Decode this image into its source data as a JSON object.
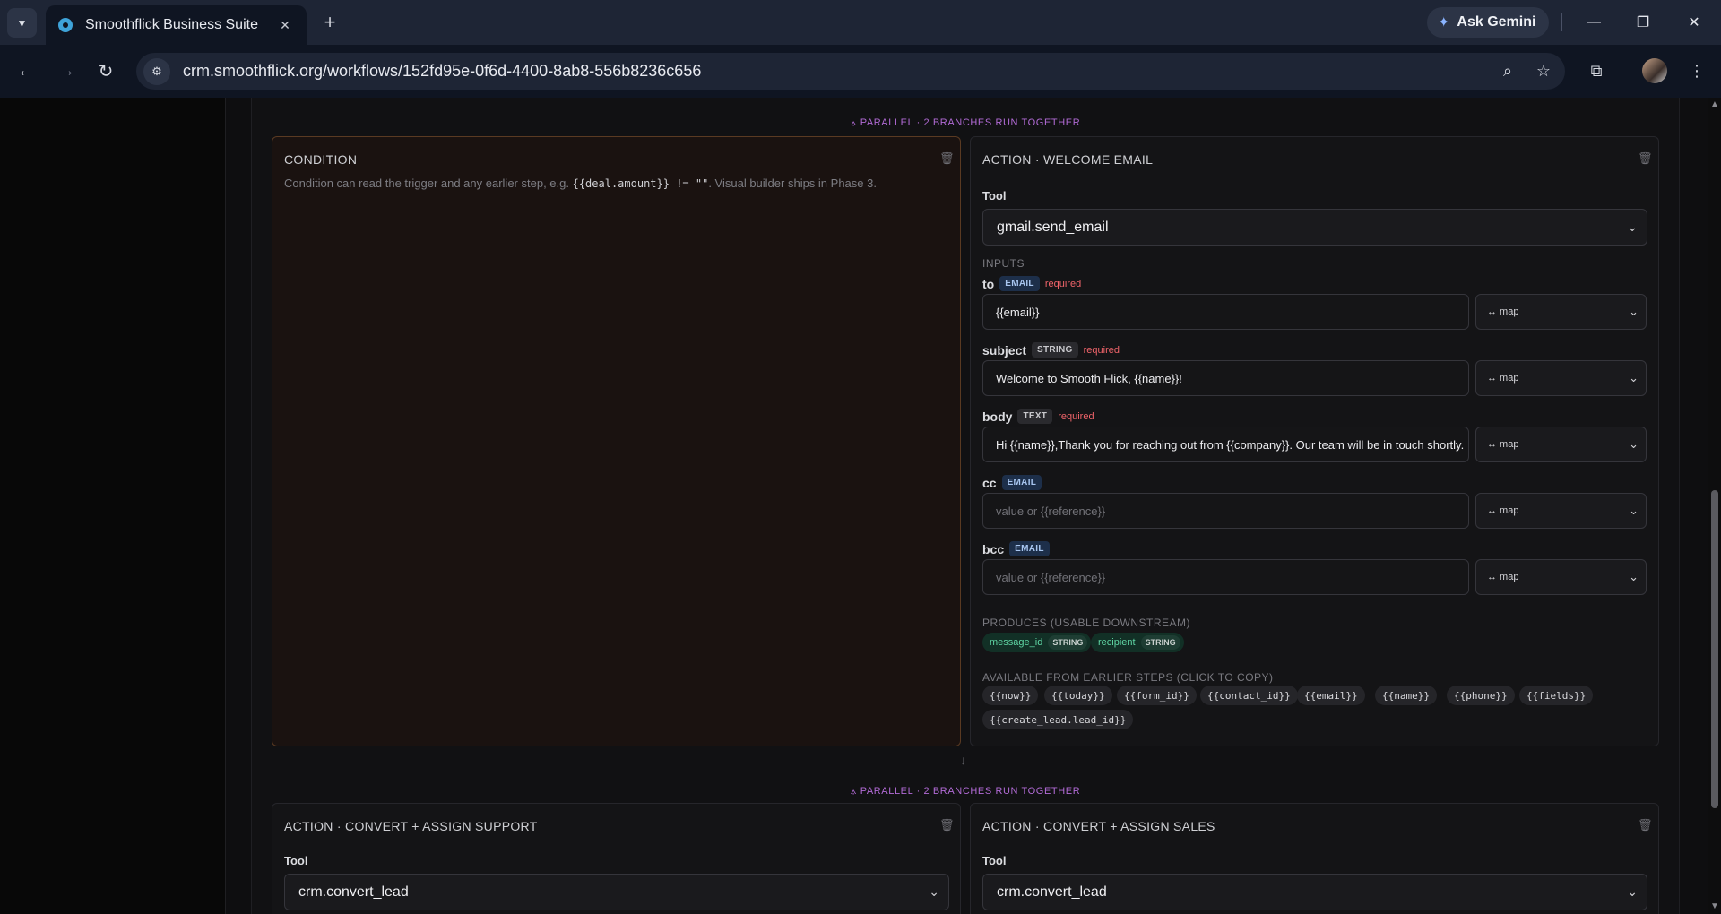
{
  "browser": {
    "tab_title": "Smoothflick Business Suite",
    "url": "crm.smoothflick.org/workflows/152fd95e-0f6d-4400-8ab8-556b8236c656",
    "gemini_label": "Ask Gemini"
  },
  "parallel_labels": {
    "top": "⟑ PARALLEL · 2 BRANCHES RUN TOGETHER",
    "bottom": "⟑ PARALLEL · 2 BRANCHES RUN TOGETHER"
  },
  "condition": {
    "title": "CONDITION",
    "hint_pre": "Condition can read the trigger and any earlier step, e.g. ",
    "hint_code": "{{deal.amount}} != \"\"",
    "hint_post": ". Visual builder ships in Phase 3."
  },
  "welcome_email": {
    "title": "ACTION · WELCOME EMAIL",
    "tool_label": "Tool",
    "tool_value": "gmail.send_email",
    "inputs_label": "INPUTS",
    "fields": [
      {
        "name": "to",
        "type": "EMAIL",
        "required": "required",
        "value": "{{email}}",
        "placeholder": "",
        "map": "↔ map"
      },
      {
        "name": "subject",
        "type": "STRING",
        "required": "required",
        "value": "Welcome to Smooth Flick, {{name}}!",
        "placeholder": "",
        "map": "↔ map"
      },
      {
        "name": "body",
        "type": "TEXT",
        "required": "required",
        "value": "Hi {{name}},Thank you for reaching out from {{company}}. Our team will be in touch shortly.",
        "placeholder": "",
        "map": "↔ map"
      },
      {
        "name": "cc",
        "type": "EMAIL",
        "required": "",
        "value": "",
        "placeholder": "value or {{reference}}",
        "map": "↔ map"
      },
      {
        "name": "bcc",
        "type": "EMAIL",
        "required": "",
        "value": "",
        "placeholder": "value or {{reference}}",
        "map": "↔ map"
      }
    ],
    "produces_label": "PRODUCES (USABLE DOWNSTREAM)",
    "produces": [
      {
        "name": "message_id",
        "type": "STRING"
      },
      {
        "name": "recipient",
        "type": "STRING"
      }
    ],
    "available_label": "AVAILABLE FROM EARLIER STEPS (CLICK TO COPY)",
    "available": [
      "{{now}}",
      "{{today}}",
      "{{form_id}}",
      "{{contact_id}}",
      "{{email}}",
      "{{name}}",
      "{{phone}}",
      "{{fields}}",
      "{{create_lead.lead_id}}"
    ]
  },
  "convert_support": {
    "title": "ACTION · CONVERT + ASSIGN SUPPORT",
    "tool_label": "Tool",
    "tool_value": "crm.convert_lead"
  },
  "convert_sales": {
    "title": "ACTION · CONVERT + ASSIGN SALES",
    "tool_label": "Tool",
    "tool_value": "crm.convert_lead"
  }
}
